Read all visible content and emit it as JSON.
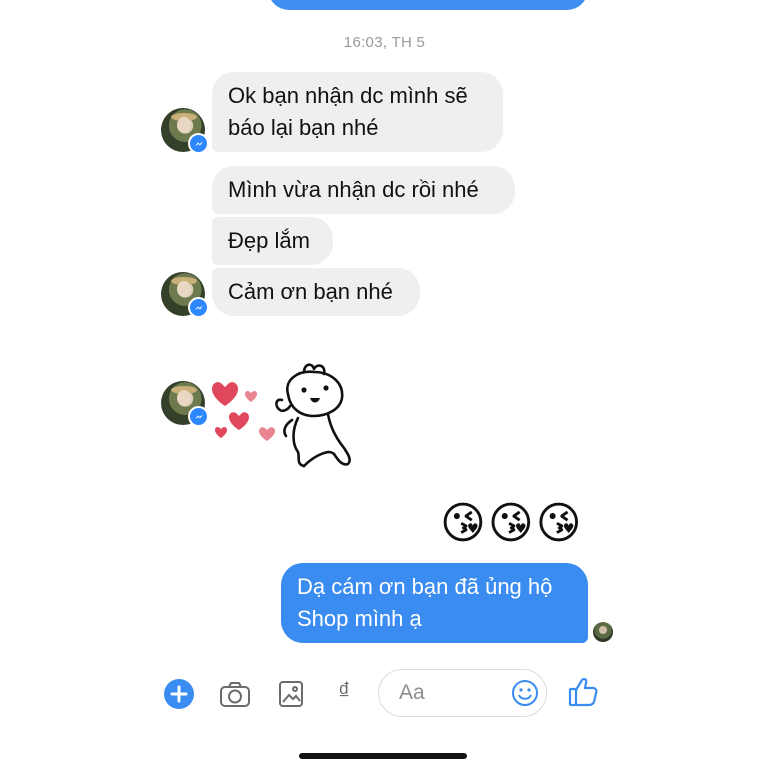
{
  "chat": {
    "timestamp": "16:03, TH 5",
    "incoming": [
      {
        "line1": "Ok bạn nhận dc mình sẽ",
        "line2": "báo lại bạn nhé"
      },
      {
        "text": "Mình vừa nhận dc rồi nhé"
      },
      {
        "text": "Đẹp lắm"
      },
      {
        "text": "Cảm ơn bạn nhé"
      }
    ],
    "outgoing": {
      "line1": "Dạ cám ơn bạn đã ủng hộ",
      "line2": "Shop mình ạ"
    },
    "emojis": [
      "😘",
      "😘",
      "😘"
    ]
  },
  "composer": {
    "placeholder": "Aa",
    "currency_symbol": "₫"
  },
  "colors": {
    "accent": "#3a8cf0",
    "incoming_bubble": "#efefef",
    "heart": "#e0475c"
  }
}
